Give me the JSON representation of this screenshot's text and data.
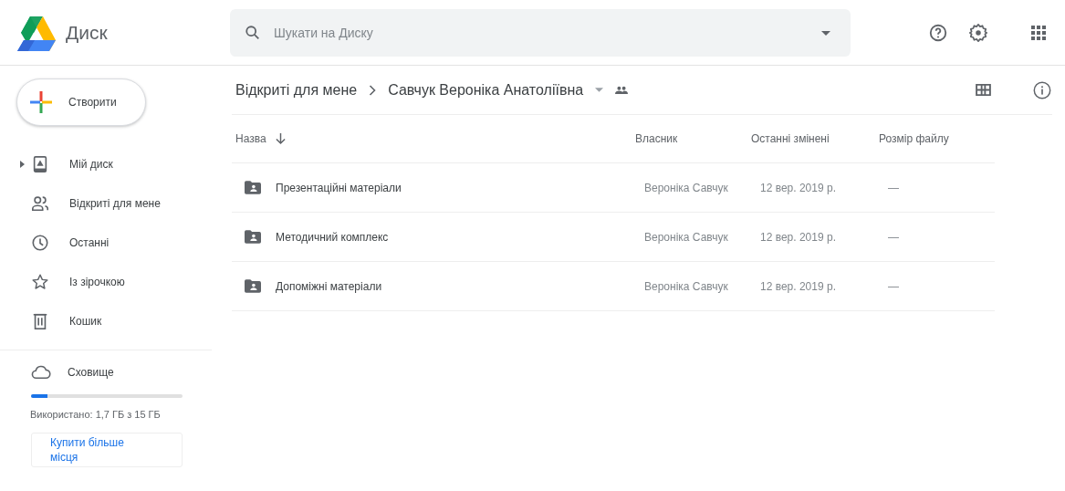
{
  "app": {
    "title": "Диск"
  },
  "search": {
    "placeholder": "Шукати на Диску"
  },
  "create_button": {
    "label": "Створити"
  },
  "sidebar": {
    "items": [
      {
        "label": "Мій диск",
        "kind": "drive",
        "expandable": true,
        "selected": false
      },
      {
        "label": "Відкриті для мене",
        "kind": "shared",
        "expandable": false,
        "selected": false
      },
      {
        "label": "Останні",
        "kind": "clock",
        "expandable": false,
        "selected": false
      },
      {
        "label": "Із зірочкою",
        "kind": "star",
        "expandable": false,
        "selected": false
      },
      {
        "label": "Кошик",
        "kind": "trash",
        "expandable": false,
        "selected": false
      }
    ]
  },
  "storage": {
    "label": "Сховище",
    "level": 0.11,
    "usage": "Використано: 1,7 ГБ з 15 ГБ",
    "buy_button": "Купити більше місця"
  },
  "breadcrumb": [
    {
      "label": "Відкриті для мене"
    },
    {
      "label": "Савчук Вероніка Анатоліївна"
    }
  ],
  "table": {
    "columns": [
      "Назва",
      "Власник",
      "Останні змінені",
      "Розмір файлу"
    ],
    "rows": [
      {
        "name": "Презентаційні матеріали",
        "owner": "Вероніка Савчук",
        "modified": "12 вер. 2019 р.",
        "size": "—"
      },
      {
        "name": "Методичний комплекс",
        "owner": "Вероніка Савчук",
        "modified": "12 вер. 2019 р.",
        "size": "—"
      },
      {
        "name": "Допоміжні матеріали",
        "owner": "Вероніка Савчук",
        "modified": "12 вер. 2019 р.",
        "size": "—"
      }
    ]
  }
}
